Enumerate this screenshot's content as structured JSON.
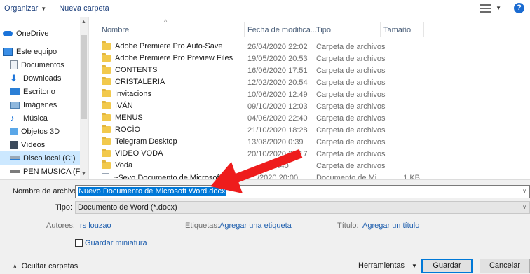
{
  "toolbar": {
    "organize_label": "Organizar",
    "new_folder_label": "Nueva carpeta",
    "help_label": "?"
  },
  "sidebar": {
    "items": [
      {
        "label": "OneDrive",
        "icon": "cloud-icon"
      },
      {
        "label": "Este equipo",
        "icon": "computer-icon"
      },
      {
        "label": "Documentos",
        "icon": "documents-icon"
      },
      {
        "label": "Downloads",
        "icon": "download-icon"
      },
      {
        "label": "Escritorio",
        "icon": "desktop-icon"
      },
      {
        "label": "Imágenes",
        "icon": "pictures-icon"
      },
      {
        "label": "Música",
        "icon": "music-icon"
      },
      {
        "label": "Objetos 3D",
        "icon": "cube-icon"
      },
      {
        "label": "Vídeos",
        "icon": "video-icon"
      },
      {
        "label": "Disco local (C:)",
        "icon": "drive-icon"
      },
      {
        "label": "PEN MÚSICA (F",
        "icon": "usb-drive-icon"
      }
    ]
  },
  "columns": {
    "name": "Nombre",
    "date": "Fecha de modifica...",
    "type": "Tipo",
    "size": "Tamaño"
  },
  "files": [
    {
      "name": "Adobe Premiere Pro Auto-Save",
      "date": "26/04/2020 22:02",
      "type": "Carpeta de archivos",
      "size": ""
    },
    {
      "name": "Adobe Premiere Pro Preview Files",
      "date": "19/05/2020 20:53",
      "type": "Carpeta de archivos",
      "size": ""
    },
    {
      "name": "CONTENTS",
      "date": "16/06/2020 17:51",
      "type": "Carpeta de archivos",
      "size": ""
    },
    {
      "name": "CRISTALERIA",
      "date": "12/02/2020 20:54",
      "type": "Carpeta de archivos",
      "size": ""
    },
    {
      "name": "Invitacions",
      "date": "10/06/2020 12:49",
      "type": "Carpeta de archivos",
      "size": ""
    },
    {
      "name": "IVÁN",
      "date": "09/10/2020 12:03",
      "type": "Carpeta de archivos",
      "size": ""
    },
    {
      "name": "MENUS",
      "date": "04/06/2020 22:40",
      "type": "Carpeta de archivos",
      "size": ""
    },
    {
      "name": "ROCÍO",
      "date": "21/10/2020 18:28",
      "type": "Carpeta de archivos",
      "size": ""
    },
    {
      "name": "Telegram Desktop",
      "date": "13/08/2020 0:39",
      "type": "Carpeta de archivos",
      "size": ""
    },
    {
      "name": "VIDEO VODA",
      "date": "20/10/2020 22:17",
      "type": "Carpeta de archivos",
      "size": ""
    },
    {
      "name": "Voda",
      "date": "0 19:40",
      "type": "Carpeta de archivos",
      "size": ""
    },
    {
      "name": "~$evo Documento de Microsoft W",
      "date": "/2020 20:00",
      "type": "Documento de Mi...",
      "size": "1 KB"
    }
  ],
  "form": {
    "filename_label": "Nombre de archivo:",
    "filename_value": "Nuevo Documento de Microsoft Word.docx",
    "type_label": "Tipo:",
    "type_value": "Documento de Word (*.docx)",
    "authors_label": "Autores:",
    "authors_value": "rs louzao",
    "tags_label": "Etiquetas:",
    "tags_value": "Agregar una etiqueta",
    "title_label": "Título:",
    "title_value": "Agregar un título",
    "thumbnail_label": "Guardar miniatura"
  },
  "footer": {
    "hide_folders_label": "Ocultar carpetas",
    "tools_label": "Herramientas",
    "save_label": "Guardar",
    "cancel_label": "Cancelar"
  },
  "colors": {
    "selection": "#0078d7",
    "link": "#1f5fae",
    "annotation_arrow": "#ee1c1c"
  }
}
